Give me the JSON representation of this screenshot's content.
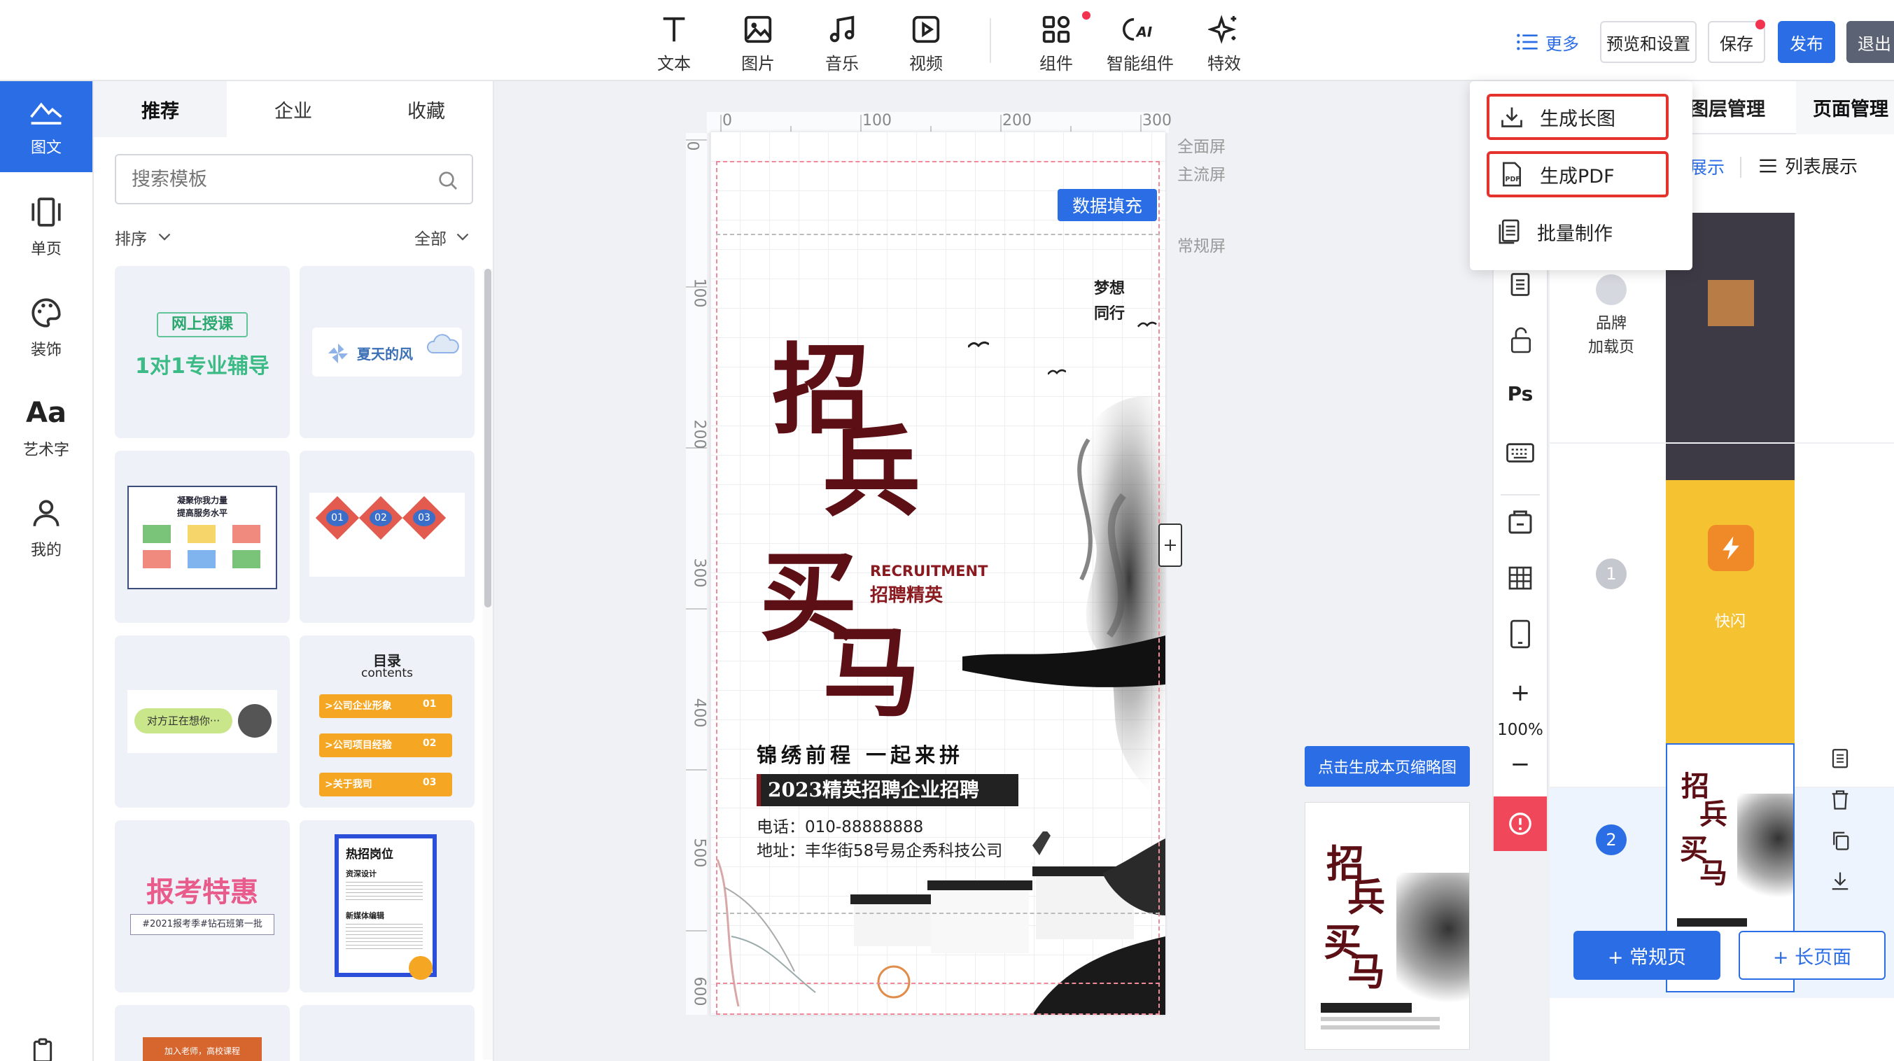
{
  "toolbar": {
    "tools": [
      {
        "label": "文本",
        "icon": "text-icon"
      },
      {
        "label": "图片",
        "icon": "image-icon"
      },
      {
        "label": "音乐",
        "icon": "music-icon"
      },
      {
        "label": "视频",
        "icon": "video-icon"
      },
      {
        "label": "组件",
        "icon": "component-icon"
      },
      {
        "label": "智能组件",
        "icon": "ai-icon"
      },
      {
        "label": "特效",
        "icon": "sparkle-icon"
      }
    ],
    "more_label": "更多",
    "preview_label": "预览和设置",
    "save_label": "保存",
    "publish_label": "发布",
    "exit_label": "退出"
  },
  "rail": {
    "items": [
      {
        "label": "图文",
        "icon": "graphic-icon"
      },
      {
        "label": "单页",
        "icon": "single-page-icon"
      },
      {
        "label": "装饰",
        "icon": "palette-icon"
      },
      {
        "label": "艺术字",
        "icon": "art-text-icon"
      },
      {
        "label": "我的",
        "icon": "user-icon"
      }
    ]
  },
  "left_panel": {
    "tabs": [
      "推荐",
      "企业",
      "收藏"
    ],
    "search_placeholder": "搜索模板",
    "sort_label": "排序",
    "filter_label": "全部",
    "templates": {
      "t1": "网上授课",
      "t1b": "1对1专业辅导",
      "t2": "夏天的风",
      "t3a": "凝聚你我力量",
      "t3b": "提高服务水平",
      "t4": [
        "01",
        "02",
        "03"
      ],
      "t5": "对方正在想你···",
      "t6title": "目录",
      "t6sub": "contents",
      "t6items": [
        {
          "text": ">公司企业形象",
          "num": "01"
        },
        {
          "text": ">公司项目经验",
          "num": "02"
        },
        {
          "text": ">关于我司",
          "num": "03"
        }
      ],
      "t7": "报考特惠",
      "t7b": "#2021报考季#钻石班第一批",
      "t8title": "热招岗位",
      "t8a": "资深设计",
      "t8b": "新媒体编辑",
      "t9": "加入老师，高校课程"
    }
  },
  "canvas": {
    "ruler_top": [
      "0",
      "100",
      "200",
      "300"
    ],
    "ruler_left": [
      "0",
      "100",
      "200",
      "300",
      "400",
      "500",
      "600"
    ],
    "screen_labels": [
      "全面屏",
      "主流屏",
      "常规屏"
    ],
    "data_fill_label": "数据填充",
    "zoom": "100%",
    "thumb_label": "点击生成本页缩略图"
  },
  "poster": {
    "motto1": "梦想",
    "motto2": "同行",
    "big1": "招",
    "big2": "兵",
    "big3": "买",
    "big4": "马",
    "recruit_en": "RECRUITMENT",
    "recruit_cn": "招聘精英",
    "slogan": "锦绣前程 一起来拼",
    "banner": "2023精英招聘企业招聘",
    "phone": "电话：010-88888888",
    "address": "地址：丰华街58号易企秀科技公司"
  },
  "dropdown": {
    "items": [
      {
        "label": "生成长图",
        "icon": "download-icon"
      },
      {
        "label": "生成PDF",
        "icon": "pdf-icon"
      },
      {
        "label": "批量制作",
        "icon": "batch-icon"
      }
    ]
  },
  "right_panel": {
    "tabs": [
      "图层管理",
      "页面管理"
    ],
    "view_a": "展示",
    "view_b": "列表展示",
    "brand_label_1": "品牌",
    "brand_label_2": "加载页",
    "page1_num": "1",
    "page1_label": "快闪",
    "page2_num": "2",
    "add_regular": "+ 常规页",
    "add_long": "+ 长页面"
  },
  "colors": {
    "accent": "#2b6de5",
    "highlight": "#e5322d",
    "poster_red": "#5c0f14"
  }
}
